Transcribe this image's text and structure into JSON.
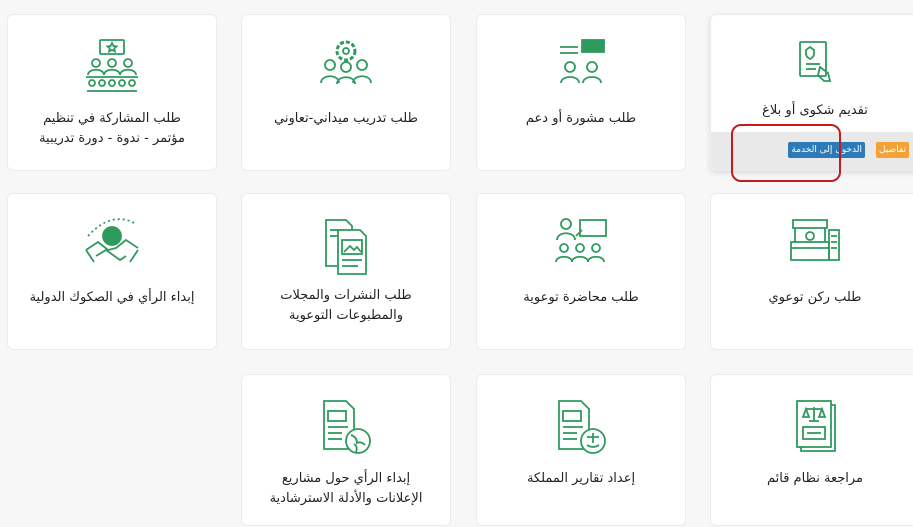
{
  "services": [
    {
      "label": "تقديم شكوى أو بلاغ",
      "icon": "complaint-form-icon"
    },
    {
      "label": "طلب مشورة أو دعم",
      "icon": "consultation-icon"
    },
    {
      "label": "طلب تدريب ميداني-تعاوني",
      "icon": "training-team-icon"
    },
    {
      "label": "طلب المشاركة في تنظيم\nمؤتمر - ندوة - دورة تدريبية",
      "icon": "conference-icon"
    },
    {
      "label": "طلب ركن توعوي",
      "icon": "booth-icon"
    },
    {
      "label": "طلب محاضرة توعوية",
      "icon": "lecture-icon"
    },
    {
      "label": "طلب النشرات والمجلات\nوالمطبوعات التوعوية",
      "icon": "publications-icon"
    },
    {
      "label": "إبداء الرأي في الصكوك الدولية",
      "icon": "global-handshake-icon"
    },
    {
      "label": "مراجعة نظام قائم",
      "icon": "law-book-icon"
    },
    {
      "label": "إعداد تقارير المملكة",
      "icon": "kingdom-report-icon"
    },
    {
      "label": "إبداء الرأي حول مشاريع\nالإعلانات والأدلة الاسترشادية",
      "icon": "document-globe-icon"
    }
  ],
  "actions": {
    "details": "تفاصيل",
    "enter": "الدخول إلى الخدمة"
  },
  "colors": {
    "icon_green": "#2f9a5e",
    "details": "#f4a234",
    "enter": "#2d7ab8",
    "highlight": "#c21c1c"
  }
}
